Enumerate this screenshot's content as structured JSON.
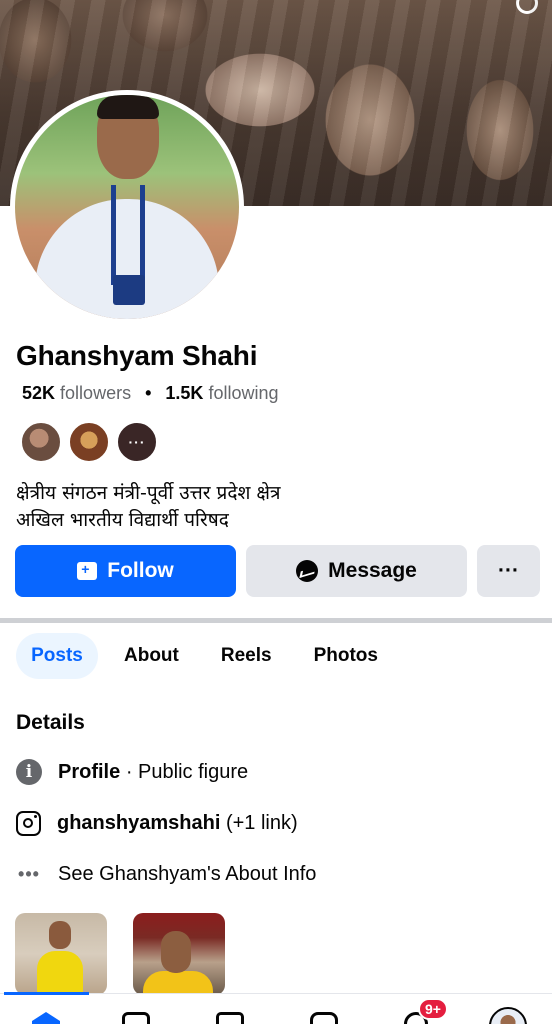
{
  "profile": {
    "name": "Ghanshyam Shahi",
    "followers_count": "52K",
    "followers_label": "followers",
    "following_count": "1.5K",
    "following_label": "following",
    "mutual_more": "···",
    "bio_line1": "क्षेत्रीय संगठन मंत्री-पूर्वी उत्तर प्रदेश क्षेत्र",
    "bio_line2": "अखिल भारतीय विद्यार्थी परिषद"
  },
  "actions": {
    "follow_label": "Follow",
    "message_label": "Message",
    "more_label": "···"
  },
  "tabs": [
    {
      "label": "Posts",
      "active": true
    },
    {
      "label": "About",
      "active": false
    },
    {
      "label": "Reels",
      "active": false
    },
    {
      "label": "Photos",
      "active": false
    }
  ],
  "details": {
    "title": "Details",
    "category_label": "Profile",
    "category_sep": "·",
    "category_value": "Public figure",
    "instagram_handle": "ghanshyamshahi",
    "instagram_extra": "(+1 link)",
    "about_link": "See Ghanshyam's About Info"
  },
  "bottom_nav": {
    "notification_badge": "9+"
  },
  "icons": {
    "follow": "add-friend-icon",
    "message": "messenger-icon",
    "info": "info-icon",
    "instagram": "instagram-icon",
    "more": "more-dots-icon"
  },
  "colors": {
    "primary": "#0866ff",
    "secondary_button": "#e4e6eb",
    "muted_text": "#65676b",
    "badge": "#e41e3f",
    "active_tab_bg": "#ebf5ff"
  }
}
